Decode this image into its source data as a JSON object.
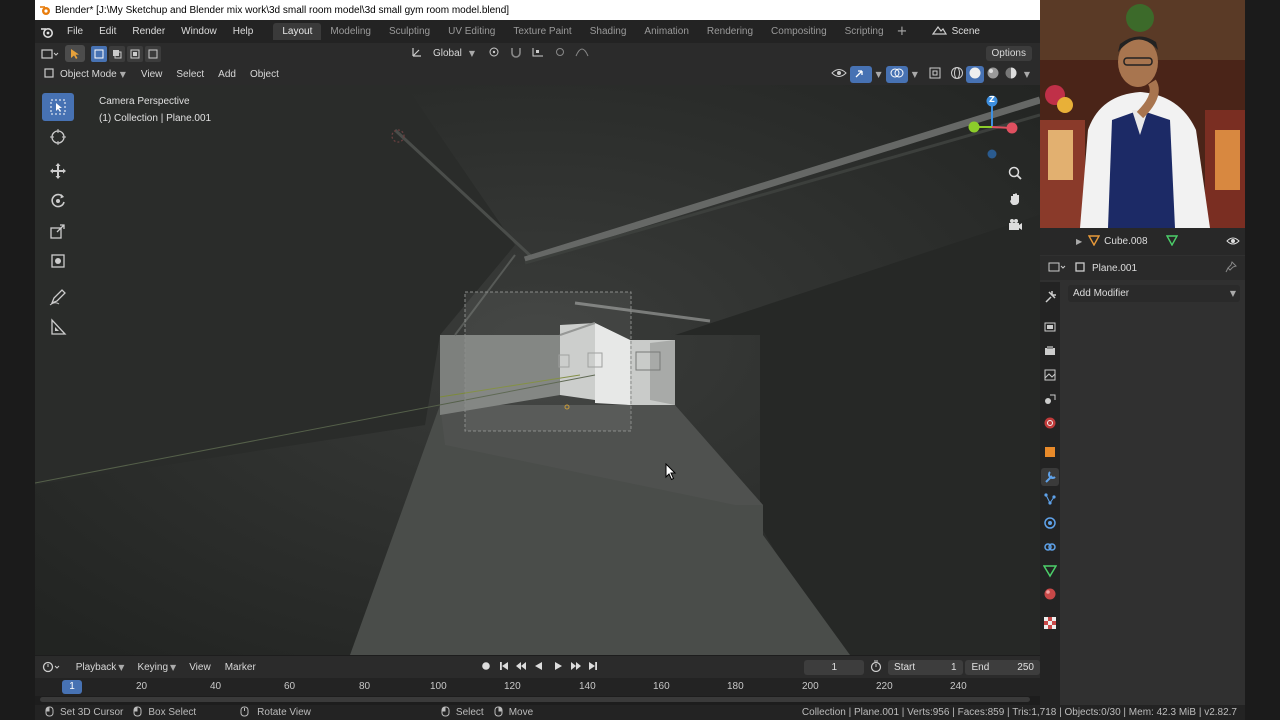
{
  "window": {
    "title": "Blender* [J:\\My Sketchup and Blender mix work\\3d small room model\\3d small gym room model.blend]"
  },
  "menu": {
    "items": [
      "File",
      "Edit",
      "Render",
      "Window",
      "Help"
    ]
  },
  "workspaces": {
    "tabs": [
      "Layout",
      "Modeling",
      "Sculpting",
      "UV Editing",
      "Texture Paint",
      "Shading",
      "Animation",
      "Rendering",
      "Compositing",
      "Scripting"
    ],
    "active": "Layout"
  },
  "scene": {
    "label": "Scene"
  },
  "tool_header": {
    "orientation": "Global",
    "options_label": "Options"
  },
  "viewport_header": {
    "mode": "Object Mode",
    "menus": [
      "View",
      "Select",
      "Add",
      "Object"
    ]
  },
  "viewport": {
    "overlay_line1": "Camera Perspective",
    "overlay_line2": "(1) Collection | Plane.001",
    "gizmo_axis": "Z"
  },
  "outliner": {
    "visible_item": "Cube.008"
  },
  "properties": {
    "object_name": "Plane.001",
    "add_modifier_label": "Add Modifier"
  },
  "timeline": {
    "menus": [
      "Playback",
      "Keying",
      "View",
      "Marker"
    ],
    "current_frame": "1",
    "start_label": "Start",
    "start_value": "1",
    "end_label": "End",
    "end_value": "250",
    "ruler_labels": [
      "1",
      "20",
      "40",
      "60",
      "80",
      "100",
      "120",
      "140",
      "160",
      "180",
      "200",
      "220",
      "240"
    ]
  },
  "status_bar": {
    "set_cursor": "Set 3D Cursor",
    "box_select": "Box Select",
    "rotate_view": "Rotate View",
    "select": "Select",
    "move": "Move",
    "stats": "Collection | Plane.001 | Verts:956 | Faces:859 | Tris:1,718 | Objects:0/30 | Mem: 42.3 MiB | v2.82.7"
  },
  "colors": {
    "accent": "#4772b3",
    "x_axis": "#e05060",
    "y_axis": "#8ccc2a",
    "z_axis": "#3d8fe0"
  }
}
